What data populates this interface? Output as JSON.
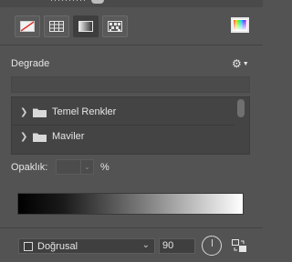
{
  "header_partial": {
    "text": "··········"
  },
  "toolbar": {
    "buttons": [
      {
        "icon": "no-color-icon",
        "selected": false
      },
      {
        "icon": "swatch-grid-icon",
        "selected": false
      },
      {
        "icon": "gradient-icon",
        "selected": true
      },
      {
        "icon": "pattern-icon",
        "selected": false
      }
    ],
    "picker_icon": "color-picker-icon"
  },
  "section": {
    "title": "Degrade"
  },
  "presets": {
    "folders": [
      {
        "label": "Temel Renkler"
      },
      {
        "label": "Maviler"
      }
    ]
  },
  "opacity": {
    "label": "Opaklık:",
    "value": "",
    "unit": "%"
  },
  "gradient": {
    "type_label": "Doğrusal",
    "angle": "90"
  },
  "colors": {
    "panel_bg": "#535353",
    "list_bg": "#444444",
    "field_bg": "#3f3f3f",
    "text": "#e6e6e6"
  }
}
